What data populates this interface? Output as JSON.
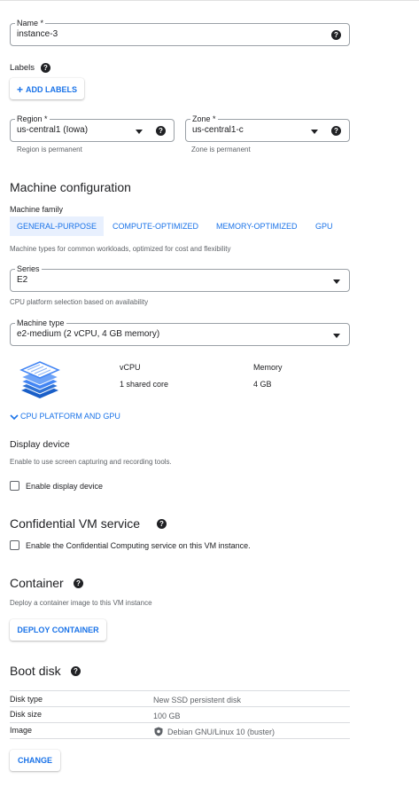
{
  "name_field": {
    "label": "Name *",
    "value": "instance-3"
  },
  "labels": {
    "title": "Labels",
    "add_button": "ADD LABELS"
  },
  "region": {
    "label": "Region *",
    "value": "us-central1 (Iowa)",
    "hint": "Region is permanent"
  },
  "zone": {
    "label": "Zone *",
    "value": "us-central1-c",
    "hint": "Zone is permanent"
  },
  "machine_config": {
    "title": "Machine configuration",
    "family_label": "Machine family",
    "tabs": [
      "GENERAL-PURPOSE",
      "COMPUTE-OPTIMIZED",
      "MEMORY-OPTIMIZED",
      "GPU"
    ],
    "family_hint": "Machine types for common workloads, optimized for cost and flexibility",
    "series": {
      "label": "Series",
      "value": "E2",
      "hint": "CPU platform selection based on availability"
    },
    "machine_type": {
      "label": "Machine type",
      "value": "e2-medium (2 vCPU, 4 GB memory)"
    },
    "vcpu_header": "vCPU",
    "vcpu_value": "1 shared core",
    "memory_header": "Memory",
    "memory_value": "4 GB",
    "cpu_platform_link": "CPU PLATFORM AND GPU"
  },
  "display_device": {
    "title": "Display device",
    "hint": "Enable to use screen capturing and recording tools.",
    "checkbox_label": "Enable display device"
  },
  "confidential": {
    "title": "Confidential VM service",
    "checkbox_label": "Enable the Confidential Computing service on this VM instance."
  },
  "container": {
    "title": "Container",
    "hint": "Deploy a container image to this VM instance",
    "button": "DEPLOY CONTAINER"
  },
  "boot_disk": {
    "title": "Boot disk",
    "rows": [
      {
        "key": "Disk type",
        "value": "New SSD persistent disk"
      },
      {
        "key": "Disk size",
        "value": "100 GB"
      },
      {
        "key": "Image",
        "value": "Debian GNU/Linux 10 (buster)"
      }
    ],
    "change_button": "CHANGE"
  },
  "colors": {
    "accent": "#1a73e8",
    "tab_active_bg": "#e8f0fe",
    "text": "#202124",
    "hint": "#5f6368"
  }
}
